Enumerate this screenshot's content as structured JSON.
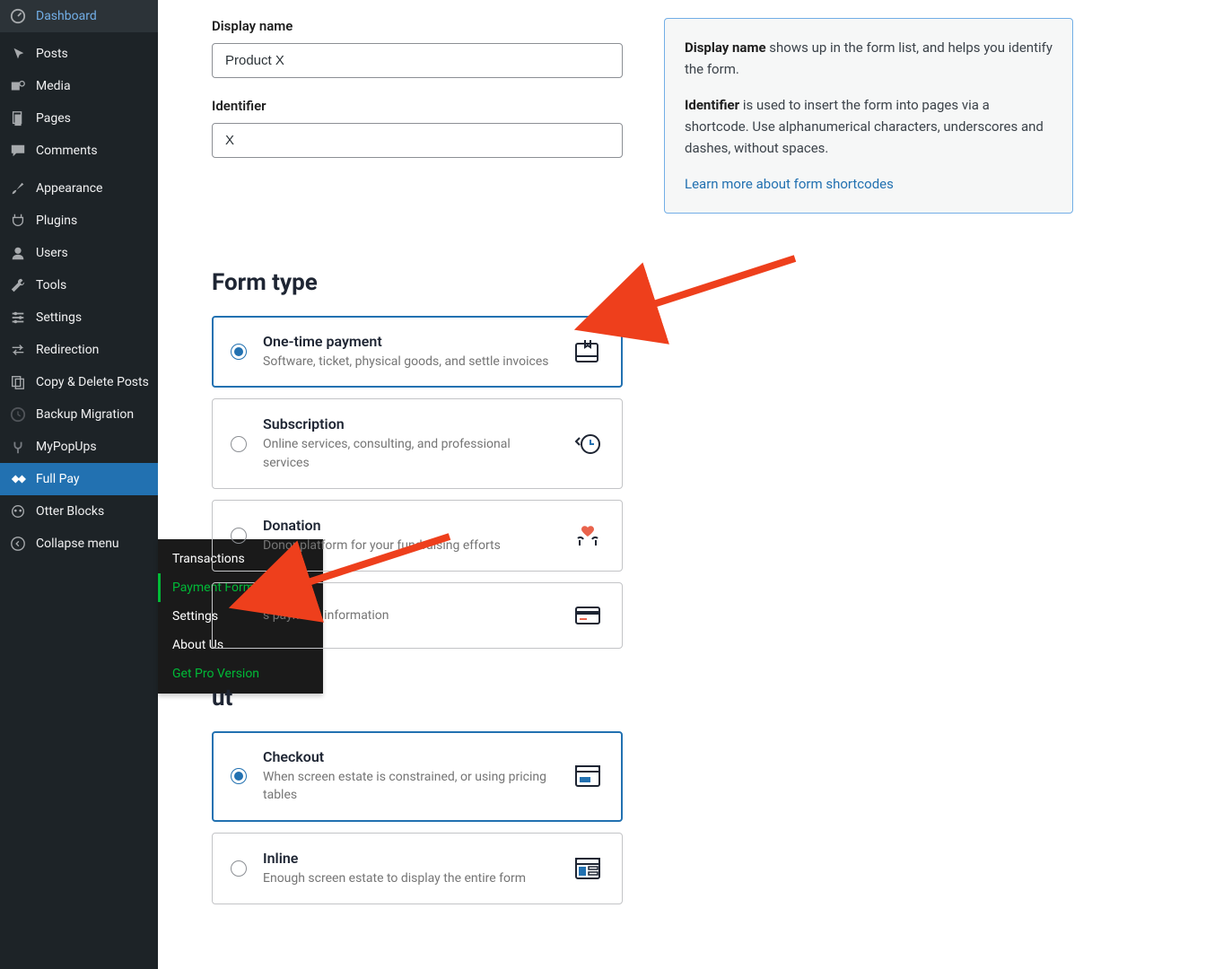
{
  "sidebar": {
    "items": [
      {
        "label": "Dashboard"
      },
      {
        "label": "Posts"
      },
      {
        "label": "Media"
      },
      {
        "label": "Pages"
      },
      {
        "label": "Comments"
      },
      {
        "label": "Appearance"
      },
      {
        "label": "Plugins"
      },
      {
        "label": "Users"
      },
      {
        "label": "Tools"
      },
      {
        "label": "Settings"
      },
      {
        "label": "Redirection"
      },
      {
        "label": "Copy & Delete Posts"
      },
      {
        "label": "Backup Migration"
      },
      {
        "label": "MyPopUps"
      },
      {
        "label": "Full Pay"
      },
      {
        "label": "Otter Blocks"
      },
      {
        "label": "Collapse menu"
      }
    ]
  },
  "submenu": {
    "items": [
      {
        "label": "Transactions"
      },
      {
        "label": "Payment Forms"
      },
      {
        "label": "Settings"
      },
      {
        "label": "About Us"
      },
      {
        "label": "Get Pro Version"
      }
    ]
  },
  "form": {
    "display_name_label": "Display name",
    "display_name_value": "Product X",
    "identifier_label": "Identifier",
    "identifier_value": "X"
  },
  "info": {
    "display_name_strong": "Display name",
    "display_name_text": " shows up in the form list, and helps you identify the form.",
    "identifier_strong": "Identifier",
    "identifier_text": " is used to insert the form into pages via a shortcode. Use alphanumerical characters, underscores and dashes, without spaces.",
    "link_text": "Learn more about form shortcodes"
  },
  "sections": {
    "form_type_title": "Form type",
    "layout_title_fragment": "ut"
  },
  "form_type_options": [
    {
      "title": "One-time payment",
      "desc": "Software, ticket, physical goods, and settle invoices"
    },
    {
      "title": "Subscription",
      "desc": "Online services, consulting, and professional services"
    },
    {
      "title": "Donation",
      "desc": "Donor platform for your fundraising efforts"
    },
    {
      "title_fragment": "",
      "desc_fragment": "s payment information"
    }
  ],
  "layout_options": [
    {
      "title": "Checkout",
      "desc": "When screen estate is constrained, or using pricing tables"
    },
    {
      "title": "Inline",
      "desc": "Enough screen estate to display the entire form"
    }
  ]
}
